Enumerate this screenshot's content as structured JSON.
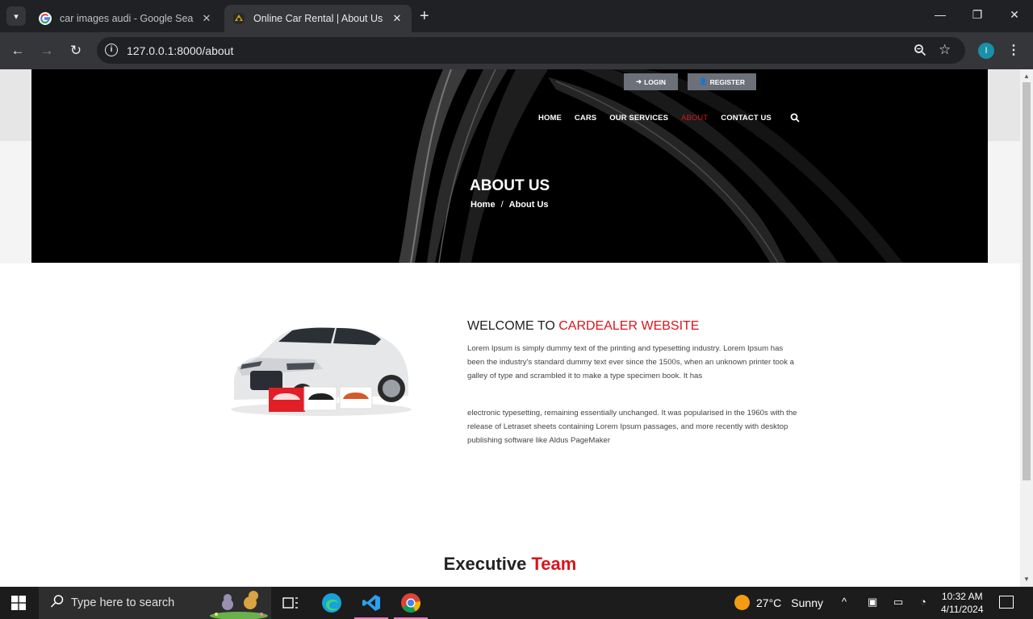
{
  "browser": {
    "tabs": [
      {
        "title": "car images audi - Google Search",
        "active": false
      },
      {
        "title": "Online Car Rental | About Us",
        "active": true
      }
    ],
    "url": "127.0.0.1:8000/about"
  },
  "site": {
    "auth": {
      "login": "LOGIN",
      "register": "REGISTER"
    },
    "nav": [
      "HOME",
      "CARS",
      "OUR SERVICES",
      "ABOUT",
      "CONTACT US"
    ],
    "active_nav": "ABOUT",
    "hero_title": "ABOUT US",
    "breadcrumb": {
      "home": "Home",
      "separator": "/",
      "current": "About Us"
    },
    "welcome": {
      "prefix": "WELCOME TO",
      "highlight": "CARDEALER WEBSITE"
    },
    "paragraphs": [
      "Lorem Ipsum is simply dummy text of the printing and typesetting industry. Lorem Ipsum has been the industry's standard dummy text ever since the 1500s, when an unknown printer took a galley of type and scrambled it to make a type specimen book. It has",
      "electronic typesetting, remaining essentially unchanged. It was popularised in the 1960s with the release of Letraset sheets containing Lorem Ipsum passages, and more recently with desktop publishing software like Aldus PageMaker"
    ],
    "section_heading": {
      "prefix": "Executive",
      "highlight": "Team"
    },
    "accent_color": "#d9141c"
  },
  "taskbar": {
    "search_placeholder": "Type here to search",
    "weather": {
      "temp": "27°C",
      "condition": "Sunny"
    },
    "time": "10:32 AM",
    "date": "4/11/2024"
  }
}
